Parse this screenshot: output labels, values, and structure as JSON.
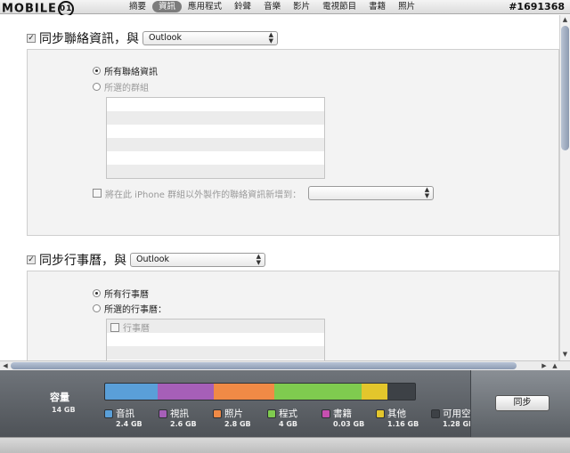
{
  "logo": {
    "text": "MOBILE",
    "ring": "01"
  },
  "watermark": "#1691368",
  "tabs": [
    {
      "label": "摘要",
      "active": false
    },
    {
      "label": "資訊",
      "active": true
    },
    {
      "label": "應用程式",
      "active": false
    },
    {
      "label": "鈴聲",
      "active": false
    },
    {
      "label": "音樂",
      "active": false
    },
    {
      "label": "影片",
      "active": false
    },
    {
      "label": "電視節目",
      "active": false
    },
    {
      "label": "書籍",
      "active": false
    },
    {
      "label": "照片",
      "active": false
    }
  ],
  "contacts": {
    "checked": true,
    "title": "同步聯絡資訊，與",
    "source": "Outlook",
    "option_all": "所有聯絡資訊",
    "option_selected": "所選的群組",
    "add_outside_label": "將在此 iPhone 群組以外製作的聯絡資訊新增到：",
    "add_outside_value": ""
  },
  "calendars": {
    "checked": true,
    "title": "同步行事曆，與",
    "source": "Outlook",
    "option_all": "所有行事曆",
    "option_selected": "所選的行事曆：",
    "list_item": "行事曆"
  },
  "capacity": {
    "label": "容量",
    "total": "14 GB",
    "segments": [
      {
        "name": "音訊",
        "size": "2.4 GB",
        "gb": 2.4,
        "color": "#5a9fd8"
      },
      {
        "name": "視訊",
        "size": "2.6 GB",
        "gb": 2.6,
        "color": "#a65fb8"
      },
      {
        "name": "照片",
        "size": "2.8 GB",
        "gb": 2.8,
        "color": "#f08a46"
      },
      {
        "name": "程式",
        "size": "4 GB",
        "gb": 4.0,
        "color": "#7fcb4f"
      },
      {
        "name": "書籍",
        "size": "0.03 GB",
        "gb": 0.03,
        "color": "#c74fb0"
      },
      {
        "name": "其他",
        "size": "1.16 GB",
        "gb": 1.16,
        "color": "#e3c62c"
      },
      {
        "name": "可用空",
        "size": "1.28 GE",
        "gb": 1.28,
        "color": "#3d4146"
      }
    ],
    "sync_button": "同步"
  }
}
